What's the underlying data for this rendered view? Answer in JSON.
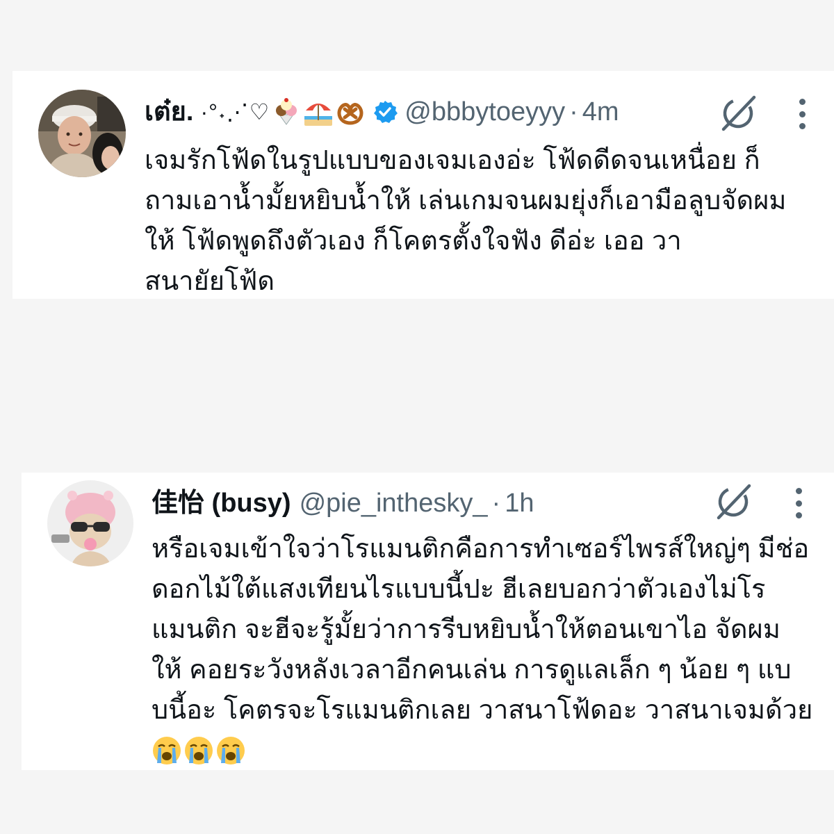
{
  "tweets": [
    {
      "display_name": "เต๋ย.",
      "name_decoration": "·°˖⋰♡",
      "name_emojis": [
        "ice-cream-icon",
        "beach-umbrella-icon",
        "pretzel-icon"
      ],
      "verified": true,
      "handle": "@bbbytoeyyy",
      "separator": "·",
      "time": "4m",
      "lines": [
        "เจมรักโฟ้ดในรูปแบบของเจมเองอ่ะ โฟ้ดดีดจนเหนื่อย ก็",
        "ถามเอาน้ำมั้ยหยิบน้ำให้ เล่นเกมจนผมยุ่งก็เอามือลูบจัดผม",
        "ให้ โฟ้ดพูดถึงตัวเอง ก็โคตรตั้งใจฟัง ดีอ่ะ เออ วา",
        "สนายัยโฟ้ด"
      ]
    },
    {
      "display_name": "佳怡 (busy)",
      "verified": false,
      "handle": "@pie_inthesky_",
      "separator": "·",
      "time": "1h",
      "lines": [
        "หรือเจมเข้าใจว่าโรแมนติกคือการทำเซอร์ไพรส์ใหญ่ๆ มีช่อ",
        "ดอกไม้ใต้แสงเทียนไรแบบนี้ปะ ฮีเลยบอกว่าตัวเองไม่โร",
        "แมนติก จะฮีจะรู้มั้ยว่าการรีบหยิบน้ำให้ตอนเขาไอ จัดผม",
        "ให้ คอยระวังหลังเวลาอีกคนเล่น การดูแลเล็ก ๆ น้อย ๆ แบ",
        "บนี้อะ โคตรจะโรแมนติกเลย วาสนาโฟ้ดอะ วาสนาเจมด้วย"
      ],
      "end_emojis": [
        "loudly-crying-face-icon",
        "loudly-crying-face-icon",
        "loudly-crying-face-icon"
      ]
    }
  ],
  "colors": {
    "background": "#f5f5f5",
    "card": "#ffffff",
    "text": "#0f1419",
    "secondary": "#536471",
    "verified": "#1d9bf0"
  }
}
